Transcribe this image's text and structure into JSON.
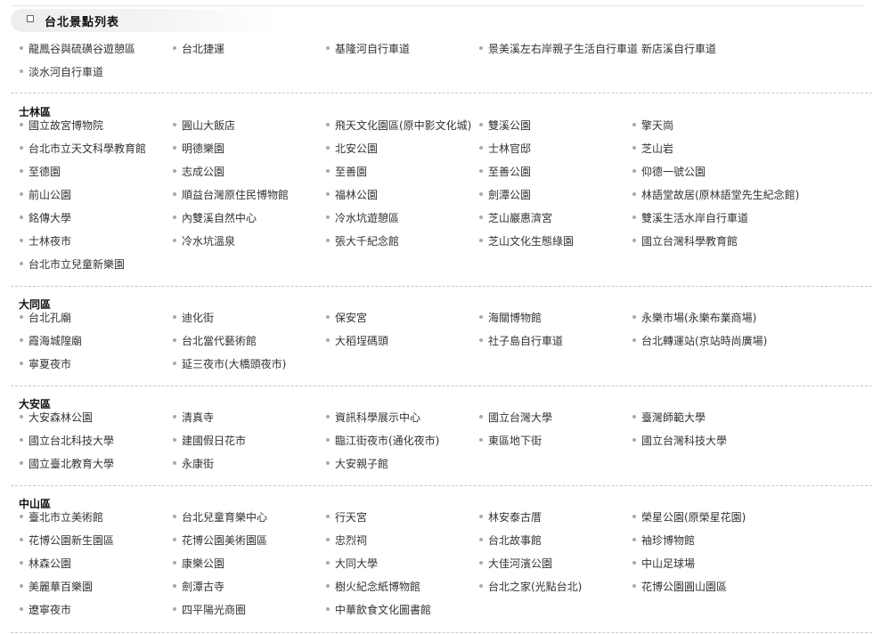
{
  "header": {
    "title": "台北景點列表"
  },
  "sections": [
    {
      "title": "",
      "items": [
        "龍鳳谷與硫磺谷遊憩區",
        "台北捷運",
        "基隆河自行車道",
        "景美溪左右岸親子生活自行車道",
        "新店溪自行車道",
        "淡水河自行車道"
      ]
    },
    {
      "title": "士林區",
      "items": [
        "國立故宮博物院",
        "圓山大飯店",
        "飛天文化園區(原中影文化城)",
        "雙溪公園",
        "擎天崗",
        "台北市立天文科學教育館",
        "明德樂園",
        "北安公園",
        "士林官邸",
        "芝山岩",
        "至德園",
        "志成公園",
        "至善園",
        "至善公園",
        "仰德一號公園",
        "前山公園",
        "順益台灣原住民博物館",
        "福林公園",
        "劍潭公園",
        "林語堂故居(原林語堂先生紀念館)",
        "銘傳大學",
        "內雙溪自然中心",
        "冷水坑遊憩區",
        "芝山巖惠濟宮",
        "雙溪生活水岸自行車道",
        "士林夜市",
        "冷水坑溫泉",
        "張大千紀念館",
        "芝山文化生態綠園",
        "國立台灣科學教育館",
        "台北市立兒童新樂園"
      ]
    },
    {
      "title": "大同區",
      "items": [
        "台北孔廟",
        "迪化街",
        "保安宮",
        "海關博物館",
        "永樂市場(永樂布業商場)",
        "霞海城隍廟",
        "台北當代藝術館",
        "大稻埕碼頭",
        "社子島自行車道",
        "台北轉運站(京站時尚廣場)",
        "寧夏夜市",
        "延三夜市(大橋頭夜市)"
      ]
    },
    {
      "title": "大安區",
      "items": [
        "大安森林公園",
        "清真寺",
        "資訊科學展示中心",
        "國立台灣大學",
        "臺灣師範大學",
        "國立台北科技大學",
        "建國假日花市",
        "臨江街夜市(通化夜市)",
        "東區地下街",
        "國立台灣科技大學",
        "國立臺北教育大學",
        "永康街",
        "大安親子館"
      ]
    },
    {
      "title": "中山區",
      "items": [
        "臺北市立美術館",
        "台北兒童育樂中心",
        "行天宮",
        "林安泰古厝",
        "榮星公園(原榮星花園)",
        "花博公園新生園區",
        "花博公園美術園區",
        "忠烈祠",
        "台北故事館",
        "袖珍博物館",
        "林森公園",
        "康樂公園",
        "大同大學",
        "大佳河濱公園",
        "中山足球場",
        "美麗華百樂園",
        "劍潭古寺",
        "樹火紀念紙博物館",
        "台北之家(光點台北)",
        "花博公園圓山園區",
        "遼寧夜市",
        "四平陽光商圈",
        "中華飲食文化圖書館"
      ]
    }
  ]
}
